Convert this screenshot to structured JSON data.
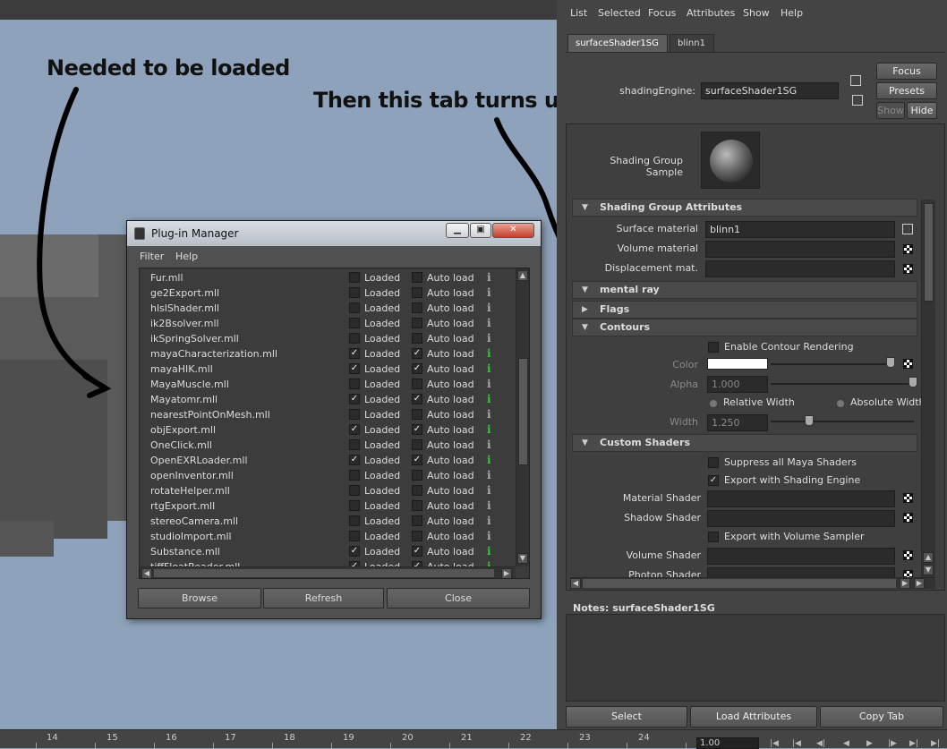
{
  "annotations": {
    "left": "Needed to be loaded",
    "right": "Then this tab turns up"
  },
  "menu": {
    "items": [
      "List",
      "Selected",
      "Focus",
      "Attributes",
      "Show",
      "Help"
    ]
  },
  "tabs": [
    "surfaceShader1SG",
    "blinn1"
  ],
  "shading_engine": {
    "label": "shadingEngine:",
    "value": "surfaceShader1SG"
  },
  "side_buttons": {
    "focus": "Focus",
    "presets": "Presets",
    "show": "Show",
    "hide": "Hide"
  },
  "sample": {
    "label": "Shading Group Sample"
  },
  "sections": {
    "shading_group": "Shading Group Attributes",
    "mental_ray": "mental ray",
    "flags": "Flags",
    "contours": "Contours",
    "custom_shaders": "Custom Shaders"
  },
  "sg_attrs": {
    "surface_label": "Surface material",
    "surface_value": "blinn1",
    "volume_label": "Volume material",
    "volume_value": "",
    "displacement_label": "Displacement mat.",
    "displacement_value": ""
  },
  "contours": {
    "enable_label": "Enable Contour Rendering",
    "enable_checked": false,
    "color_label": "Color",
    "color_value": "#ffffff",
    "alpha_label": "Alpha",
    "alpha_value": "1.000",
    "relative_width": "Relative Width",
    "absolute_width": "Absolute Width",
    "width_label": "Width",
    "width_value": "1.250"
  },
  "custom_shaders": {
    "suppress_label": "Suppress all Maya Shaders",
    "suppress_checked": false,
    "export_label": "Export with Shading Engine",
    "export_checked": true,
    "material_label": "Material Shader",
    "shadow_label": "Shadow Shader",
    "export_volume_label": "Export with Volume Sampler",
    "export_volume_checked": false,
    "volume_label": "Volume Shader",
    "photon_label": "Photon Shader"
  },
  "notes": {
    "label": "Notes:  surfaceShader1SG"
  },
  "bottom_buttons": {
    "select": "Select",
    "load": "Load Attributes",
    "copy": "Copy Tab"
  },
  "timeline": {
    "ticks": [
      "14",
      "15",
      "16",
      "17",
      "18",
      "19",
      "20",
      "21",
      "22",
      "23",
      "24"
    ],
    "time_value": "1.00"
  },
  "plugin_manager": {
    "title": "Plug-in Manager",
    "menu": [
      "Filter",
      "Help"
    ],
    "loaded_label": "Loaded",
    "autoload_label": "Auto load",
    "info_symbol": "i",
    "plugins": [
      {
        "name": "Fur.mll",
        "loaded": false,
        "auto": false
      },
      {
        "name": "ge2Export.mll",
        "loaded": false,
        "auto": false
      },
      {
        "name": "hlslShader.mll",
        "loaded": false,
        "auto": false
      },
      {
        "name": "ik2Bsolver.mll",
        "loaded": false,
        "auto": false
      },
      {
        "name": "ikSpringSolver.mll",
        "loaded": false,
        "auto": false
      },
      {
        "name": "mayaCharacterization.mll",
        "loaded": true,
        "auto": true
      },
      {
        "name": "mayaHIK.mll",
        "loaded": true,
        "auto": true
      },
      {
        "name": "MayaMuscle.mll",
        "loaded": false,
        "auto": false
      },
      {
        "name": "Mayatomr.mll",
        "loaded": true,
        "auto": true
      },
      {
        "name": "nearestPointOnMesh.mll",
        "loaded": false,
        "auto": false
      },
      {
        "name": "objExport.mll",
        "loaded": true,
        "auto": true
      },
      {
        "name": "OneClick.mll",
        "loaded": false,
        "auto": false
      },
      {
        "name": "OpenEXRLoader.mll",
        "loaded": true,
        "auto": true
      },
      {
        "name": "openInventor.mll",
        "loaded": false,
        "auto": false
      },
      {
        "name": "rotateHelper.mll",
        "loaded": false,
        "auto": false
      },
      {
        "name": "rtgExport.mll",
        "loaded": false,
        "auto": false
      },
      {
        "name": "stereoCamera.mll",
        "loaded": false,
        "auto": false
      },
      {
        "name": "studioImport.mll",
        "loaded": false,
        "auto": false
      },
      {
        "name": "Substance.mll",
        "loaded": true,
        "auto": true
      },
      {
        "name": "tiffFloatReader.mll",
        "loaded": true,
        "auto": true
      }
    ],
    "buttons": {
      "browse": "Browse",
      "refresh": "Refresh",
      "close": "Close"
    }
  },
  "colors": {
    "viewport_bg": "#8ea3bb",
    "panel_bg": "#444444",
    "info_loaded": "#2ecc2e",
    "info_unloaded": "#aaaaaa"
  }
}
